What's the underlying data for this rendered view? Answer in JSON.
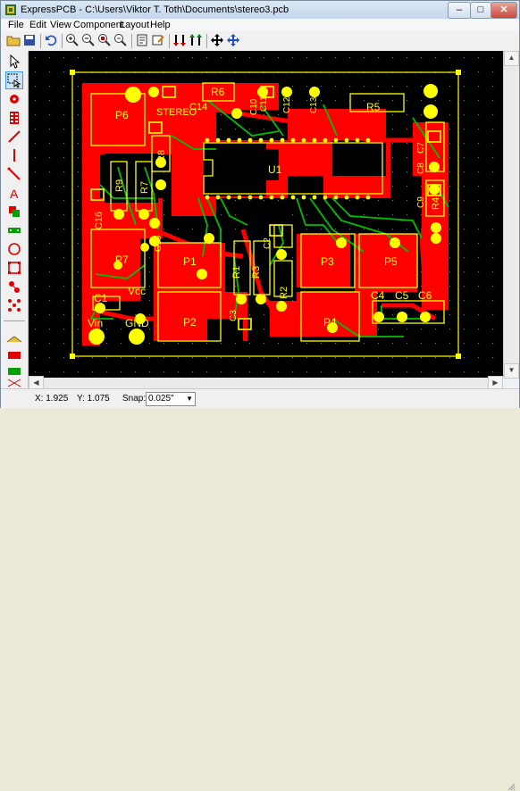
{
  "window": {
    "title": "ExpressPCB - C:\\Users\\Viktor T. Toth\\Documents\\stereo3.pcb",
    "min": "–",
    "max": "□",
    "close": "✕"
  },
  "menu": [
    "File",
    "Edit",
    "View",
    "Component",
    "Layout",
    "Help"
  ],
  "toolbar": {
    "icons": [
      "open-icon",
      "save-icon",
      "undo-icon",
      "zoom-in-icon",
      "zoom-out-icon",
      "zoom-fit-icon",
      "zoom-prev-icon",
      "print-setup-icon",
      "properties-icon",
      "top-layer-icon",
      "bottom-layer-icon",
      "move-icon",
      "pan-icon"
    ]
  },
  "tools": {
    "icons": [
      "pointer-icon",
      "select-area-icon",
      "pad-icon",
      "component-icon",
      "trace-icon",
      "line-icon",
      "diagonal-icon",
      "text-icon",
      "layer-swap-icon",
      "connector-icon",
      "circle-icon",
      "rectangle-icon",
      "net-icon",
      "ratsnest-icon"
    ],
    "layer_icons": [
      "layer-top-icon",
      "layer-bottom-icon",
      "layer-silk-icon",
      "drc-icon"
    ]
  },
  "board": {
    "colors": {
      "top_copper": "#ff0000",
      "bottom_trace": "#00c000",
      "silkscreen": "#ffff00",
      "background": "#000000"
    },
    "labels": {
      "p6": "P6",
      "stereo": "STEREO",
      "r6": "R6",
      "c14": "C14",
      "r5": "R5",
      "c11": "C11",
      "c12": "C12",
      "c13": "C13",
      "c10": "C10",
      "c7": "C7",
      "c8": "C8",
      "c9": "C9",
      "r4": "R4",
      "r8": "R8",
      "r9": "R9",
      "r7": "R7",
      "u1": "U1",
      "c16": "C16",
      "c15": "C15",
      "p7": "P7",
      "c2": "C2",
      "r1": "R1",
      "r3": "R3",
      "r2": "R2",
      "c3": "C3",
      "p1": "P1",
      "p2": "P2",
      "p3": "P3",
      "p4": "P4",
      "p5": "P5",
      "c4": "C4",
      "c5": "C5",
      "c6": "C6",
      "c1": "C1",
      "vcc": "Vcc",
      "vin": "Vin",
      "gnd": "GND"
    }
  },
  "status": {
    "x": "X: 1.925",
    "y": "Y: 1.075",
    "snap_label": "Snap:",
    "snap_value": "0.025\""
  }
}
